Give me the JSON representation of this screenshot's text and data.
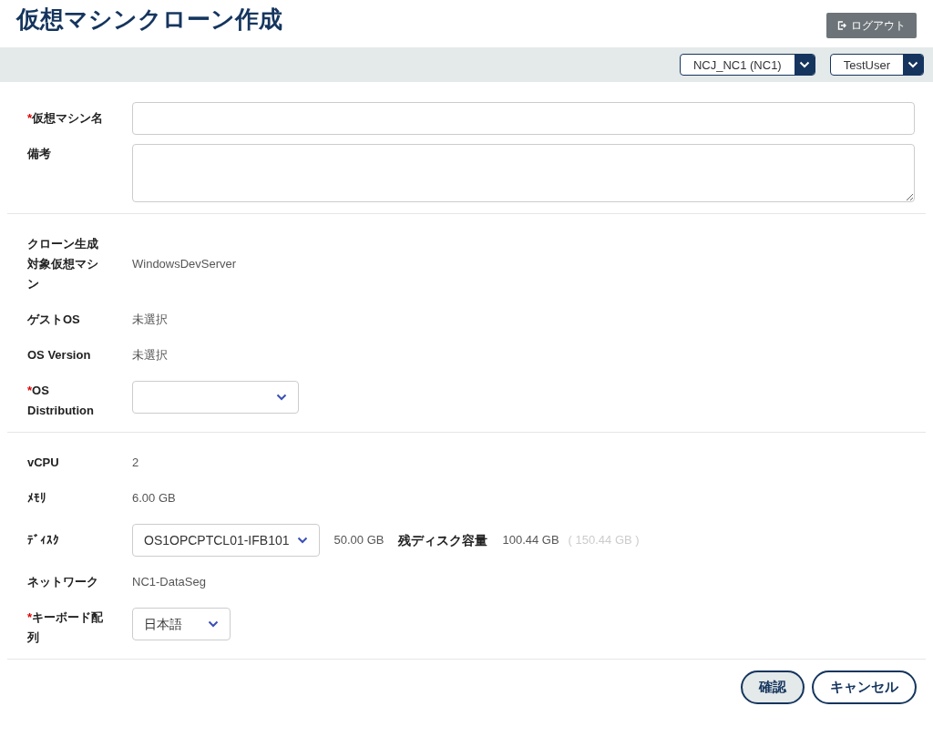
{
  "title": "仮想マシンクローン作成",
  "required_mark": "*",
  "logout_button": {
    "label": "ログアウト"
  },
  "selectors": [
    {
      "value": "NCJ_NC1 (NC1)"
    },
    {
      "value": "TestUser"
    }
  ],
  "sections": [
    {
      "rows": [
        {
          "kind": "input",
          "label": "仮想マシン名",
          "required": true
        },
        {
          "kind": "textarea",
          "label": "備考",
          "required": false
        }
      ]
    },
    {
      "rows": [
        {
          "kind": "value",
          "label": "クローン生成対象仮想マシン",
          "required": false,
          "value": "WindowsDevServer"
        },
        {
          "kind": "value",
          "label": "ゲストOS",
          "required": false,
          "value": "未選択"
        },
        {
          "kind": "value",
          "label": "OS Version",
          "required": false,
          "value": "未選択"
        },
        {
          "kind": "select",
          "label": "OS Distribution",
          "required": true,
          "value": ""
        }
      ]
    },
    {
      "rows": [
        {
          "kind": "value",
          "label": "vCPU",
          "required": false,
          "value": "2"
        },
        {
          "kind": "value",
          "label": "ﾒﾓﾘ",
          "required": false,
          "value": "6.00 GB"
        },
        {
          "kind": "disk",
          "label": "ﾃﾞｨｽｸ",
          "required": false,
          "value": "OS1OPCPTCL01-IFB101",
          "size_text": "50.00 GB",
          "remaining_label": "残ディスク容量",
          "remaining": "100.44 GB",
          "total": "( 150.44 GB )"
        },
        {
          "kind": "value",
          "label": "ネットワーク",
          "required": false,
          "value": "NC1-DataSeg"
        },
        {
          "kind": "select",
          "label": "キーボード配列",
          "required": true,
          "value": "日本語"
        }
      ]
    }
  ],
  "buttons": [
    {
      "label": "確認",
      "primary": true
    },
    {
      "label": "キャンセル",
      "primary": false
    }
  ]
}
